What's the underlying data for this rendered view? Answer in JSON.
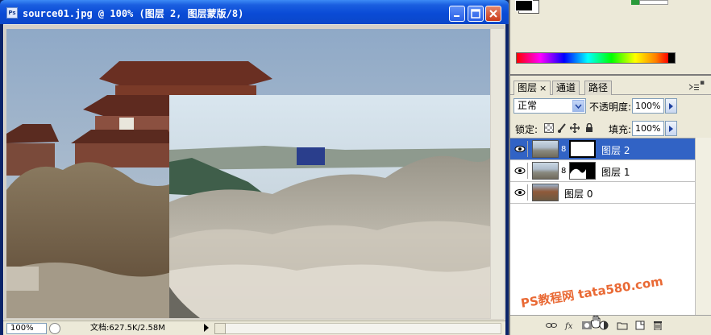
{
  "window": {
    "icon_text": "Ps",
    "title": "source01.jpg @ 100% (图层 2, 图层蒙版/8)",
    "buttons": [
      "minimize",
      "maximize",
      "close"
    ]
  },
  "status_bar": {
    "zoom": "100%",
    "doc_info": "文档:627.5K/2.58M"
  },
  "layers_panel": {
    "tabs": [
      {
        "label": "图层",
        "active": true
      },
      {
        "label": "通道",
        "active": false
      },
      {
        "label": "路径",
        "active": false
      }
    ],
    "blend_mode": "正常",
    "opacity_label": "不透明度:",
    "opacity_value": "100%",
    "lock_label": "锁定:",
    "fill_label": "填充:",
    "fill_value": "100%",
    "layers": [
      {
        "name": "图层 2",
        "selected": true,
        "mask": "white"
      },
      {
        "name": "图层 1",
        "selected": false,
        "mask": "black-with-white"
      },
      {
        "name": "图层 0",
        "selected": false,
        "mask": null
      }
    ]
  },
  "watermark": "PS教程网 tata580.com",
  "colors": {
    "titlebar": "#0b47c9",
    "selection": "#3163c5",
    "panel_bg": "#ece9d8",
    "watermark": "#e8612a"
  }
}
